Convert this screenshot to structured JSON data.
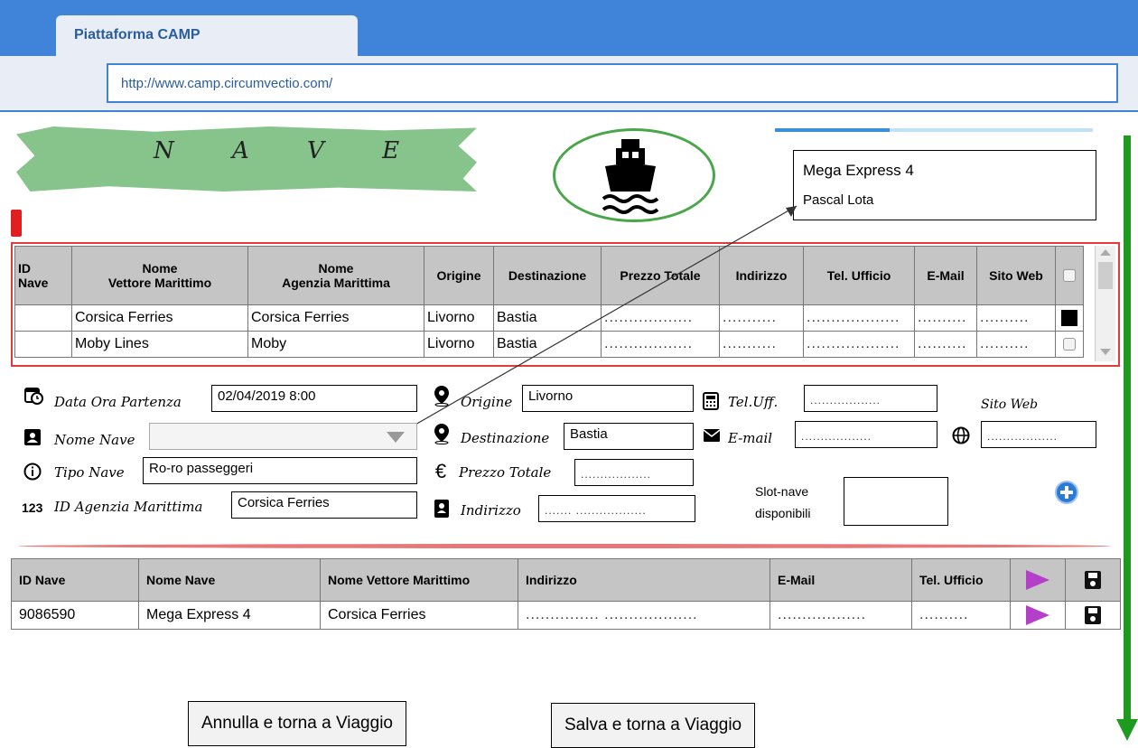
{
  "browser": {
    "tab_title": "Piattaforma CAMP",
    "url": "http://www.camp.circumvectio.com/"
  },
  "header": {
    "title": "N A V E",
    "ship_icon": "ship-icon",
    "progress": 0.36,
    "ship_card": {
      "name": "Mega Express 4",
      "owner": "Pascal Lota"
    }
  },
  "top_table": {
    "columns": [
      "ID Nave",
      "Nome Vettore Marittimo",
      "Nome Agenzia Marittima",
      "Origine",
      "Destinazione",
      "Prezzo Totale",
      "Indirizzo",
      "Tel. Ufficio",
      "E-Mail",
      "Sito Web"
    ],
    "col_lines": [
      [
        "ID",
        "Nave"
      ],
      [
        "Nome",
        "Vettore Marittimo"
      ],
      [
        "Nome",
        "Agenzia Marittima"
      ]
    ],
    "rows": [
      {
        "id": "",
        "vettore": "Corsica Ferries",
        "agenzia": "Corsica Ferries",
        "origine": "Livorno",
        "destinazione": "Bastia",
        "prezzo": "..................",
        "indirizzo": "...........",
        "tel": "...................",
        "email": "..........",
        "sito": "..........",
        "checked": true
      },
      {
        "id": "",
        "vettore": "Moby Lines",
        "agenzia": "Moby",
        "origine": "Livorno",
        "destinazione": "Bastia",
        "prezzo": "..................",
        "indirizzo": "...........",
        "tel": "...................",
        "email": "..........",
        "sito": "..........",
        "checked": false
      }
    ]
  },
  "form": {
    "data_ora_label": "Data Ora Partenza",
    "data_ora_value": "02/04/2019    8:00",
    "nome_nave_label": "Nome Nave",
    "nome_nave_value": "",
    "tipo_nave_label": "Tipo Nave",
    "tipo_nave_value": "Ro-ro passeggeri",
    "id_agenzia_label": "ID Agenzia Marittima",
    "id_agenzia_value": "Corsica Ferries",
    "id_prefix": "123",
    "origine_label": "Origine",
    "origine_value": "Livorno",
    "destinazione_label": "Destinazione",
    "destinazione_value": "Bastia",
    "prezzo_label": "Prezzo Totale",
    "prezzo_value": "..................",
    "indirizzo_label": "Indirizzo",
    "indirizzo_value": "....... ..................",
    "tel_label": "Tel.Uff.",
    "tel_value": "..................",
    "email_label": "E-mail",
    "email_value": "..................",
    "sito_label": "Sito Web",
    "sito_value": "..................",
    "slot_label_1": "Slot-nave",
    "slot_label_2": "disponibili",
    "slot_value": ""
  },
  "bottom_table": {
    "columns": [
      "ID Nave",
      "Nome Nave",
      "Nome Vettore Marittimo",
      "Indirizzo",
      "E-Mail",
      "Tel. Ufficio"
    ],
    "row": {
      "id": "9086590",
      "nome": "Mega Express 4",
      "vettore": "Corsica Ferries",
      "indirizzo": "............... ...................",
      "email": "..................",
      "tel": ".........."
    }
  },
  "buttons": {
    "annulla": "Annulla e torna a Viaggio",
    "salva": "Salva e torna a Viaggio"
  },
  "colors": {
    "accent": "#3f84d8",
    "table_border": "#e23b3b",
    "play": "#b43fc8",
    "arrow": "#1e9b1e"
  }
}
